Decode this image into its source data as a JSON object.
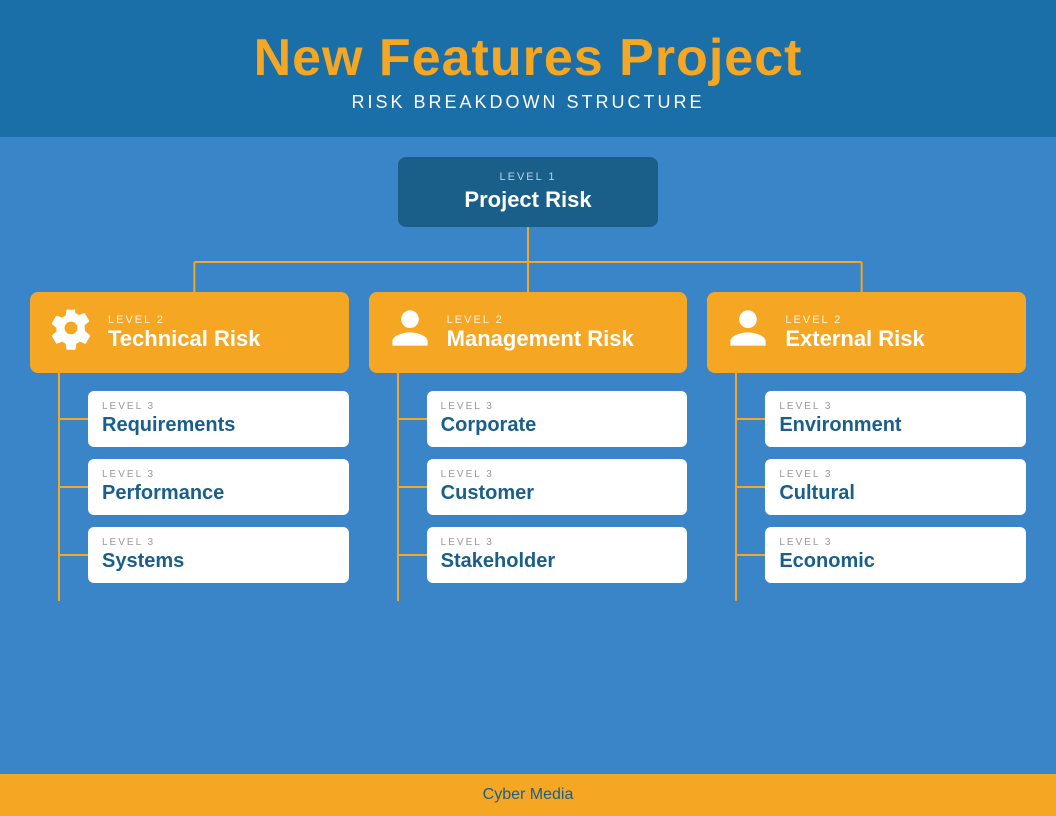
{
  "header": {
    "title": "New Features Project",
    "subtitle": "RISK BREAKDOWN STRUCTURE"
  },
  "footer": {
    "text": "Cyber Media"
  },
  "tree": {
    "level1": {
      "label": "LEVEL 1",
      "title": "Project Risk"
    },
    "level2": [
      {
        "label": "LEVEL 2",
        "title": "Technical Risk",
        "icon": "gear",
        "children": [
          {
            "label": "LEVEL 3",
            "title": "Requirements"
          },
          {
            "label": "LEVEL 3",
            "title": "Performance"
          },
          {
            "label": "LEVEL 3",
            "title": "Systems"
          }
        ]
      },
      {
        "label": "LEVEL 2",
        "title": "Management Risk",
        "icon": "person",
        "children": [
          {
            "label": "LEVEL 3",
            "title": "Corporate"
          },
          {
            "label": "LEVEL 3",
            "title": "Customer"
          },
          {
            "label": "LEVEL 3",
            "title": "Stakeholder"
          }
        ]
      },
      {
        "label": "LEVEL 2",
        "title": "External Risk",
        "icon": "person",
        "children": [
          {
            "label": "LEVEL 3",
            "title": "Environment"
          },
          {
            "label": "LEVEL 3",
            "title": "Cultural"
          },
          {
            "label": "LEVEL 3",
            "title": "Economic"
          }
        ]
      }
    ]
  },
  "colors": {
    "header_bg": "#1a6fa8",
    "main_bg": "#3a85c8",
    "l1_bg": "#1a5f8a",
    "l2_bg": "#f5a623",
    "l3_bg": "#ffffff",
    "connector": "#f5a623",
    "footer_bg": "#f5a623",
    "footer_text": "#1a5f8a",
    "l3_title": "#1a5f8a"
  }
}
